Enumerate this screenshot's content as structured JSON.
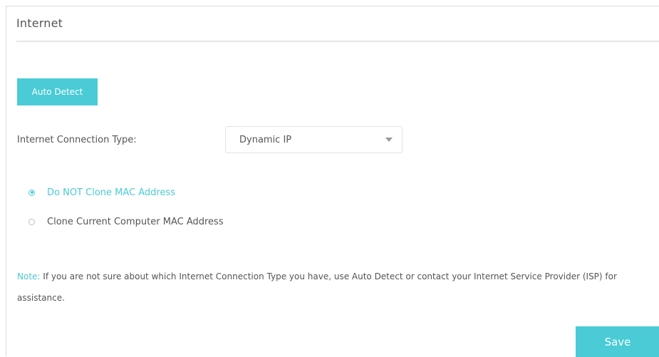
{
  "section": {
    "title": "Internet"
  },
  "auto_detect": {
    "label": "Auto Detect"
  },
  "connection_type": {
    "label": "Internet Connection Type:",
    "selected": "Dynamic IP"
  },
  "mac_options": [
    {
      "label": "Do NOT Clone MAC Address",
      "checked": true
    },
    {
      "label": "Clone Current Computer MAC Address",
      "checked": false
    }
  ],
  "note": {
    "prefix": "Note:",
    "text": "If you are not sure about which Internet Connection Type you have, use Auto Detect or contact your Internet Service Provider (ISP) for assistance."
  },
  "save": {
    "label": "Save"
  },
  "colors": {
    "accent": "#4acbd6",
    "text": "#555555"
  }
}
